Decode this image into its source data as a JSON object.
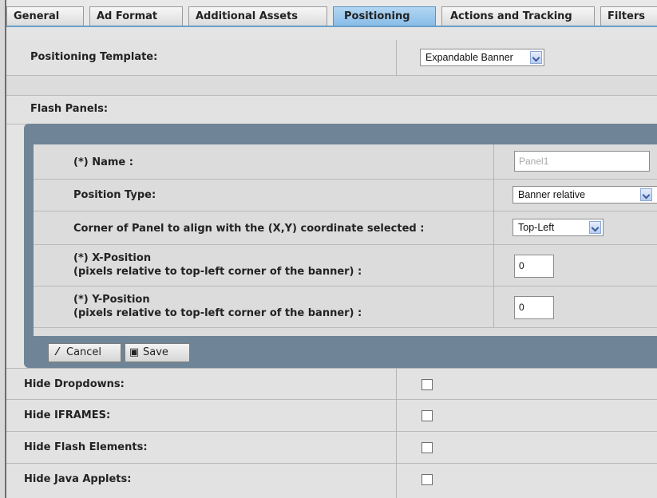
{
  "tabs": [
    {
      "label": "General",
      "active": false
    },
    {
      "label": "Ad Format",
      "active": false
    },
    {
      "label": "Additional Assets",
      "active": false
    },
    {
      "label": "Positioning",
      "active": true
    },
    {
      "label": "Actions and Tracking",
      "active": false
    },
    {
      "label": "Filters",
      "active": false
    }
  ],
  "positioning_template": {
    "label": "Positioning Template:",
    "value": "Expandable Banner"
  },
  "flash_panels": {
    "label": "Flash Panels:",
    "name": {
      "label": "(*) Name :",
      "placeholder": "Panel1"
    },
    "position_type": {
      "label": "Position Type:",
      "value": "Banner relative"
    },
    "corner": {
      "label": "Corner of Panel to align with the (X,Y) coordinate selected :",
      "value": "Top-Left"
    },
    "x_position": {
      "label": "(*) X-Position",
      "sublabel": "(pixels relative to top-left corner of the banner) :",
      "value": "0"
    },
    "y_position": {
      "label": "(*) Y-Position",
      "sublabel": "(pixels relative to top-left corner of the banner) :",
      "value": "0"
    },
    "cancel_label": "Cancel",
    "save_label": "Save"
  },
  "hide_options": [
    {
      "label": "Hide Dropdowns:",
      "checked": false
    },
    {
      "label": "Hide IFRAMES:",
      "checked": false
    },
    {
      "label": "Hide Flash Elements:",
      "checked": false
    },
    {
      "label": "Hide Java Applets:",
      "checked": false
    }
  ],
  "colors": {
    "active_tab": "#87bde8",
    "panel_frame": "#6f8597"
  },
  "icons": {
    "cancel": "pencil-icon",
    "save": "floppy-disk-icon"
  }
}
